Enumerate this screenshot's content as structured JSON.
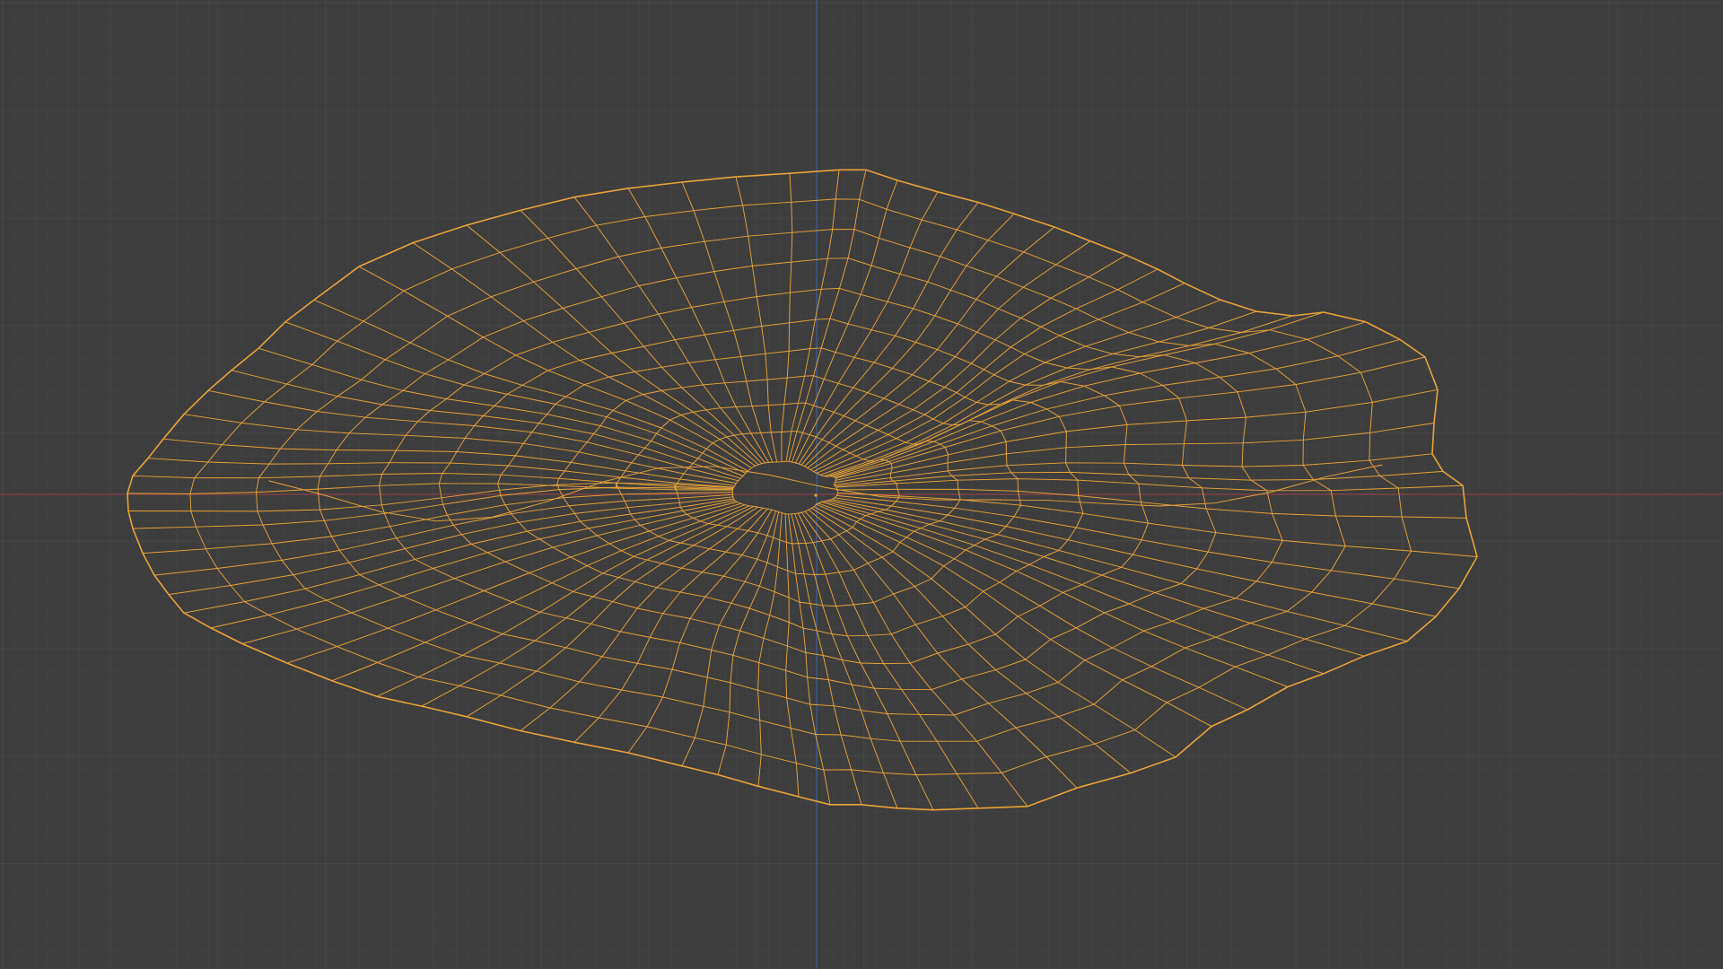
{
  "viewport": {
    "background": "#3d3d3d",
    "grid_minor_color": "#454545",
    "grid_major_color": "#4b4b4b",
    "x_axis_color": "#8a4349",
    "y_axis_color": "#3c5f92",
    "grid_visible": true,
    "axes_visible": [
      "X",
      "Y"
    ]
  },
  "object": {
    "shading": "wireframe",
    "selected": true,
    "wire_color": "#e8a33a"
  }
}
